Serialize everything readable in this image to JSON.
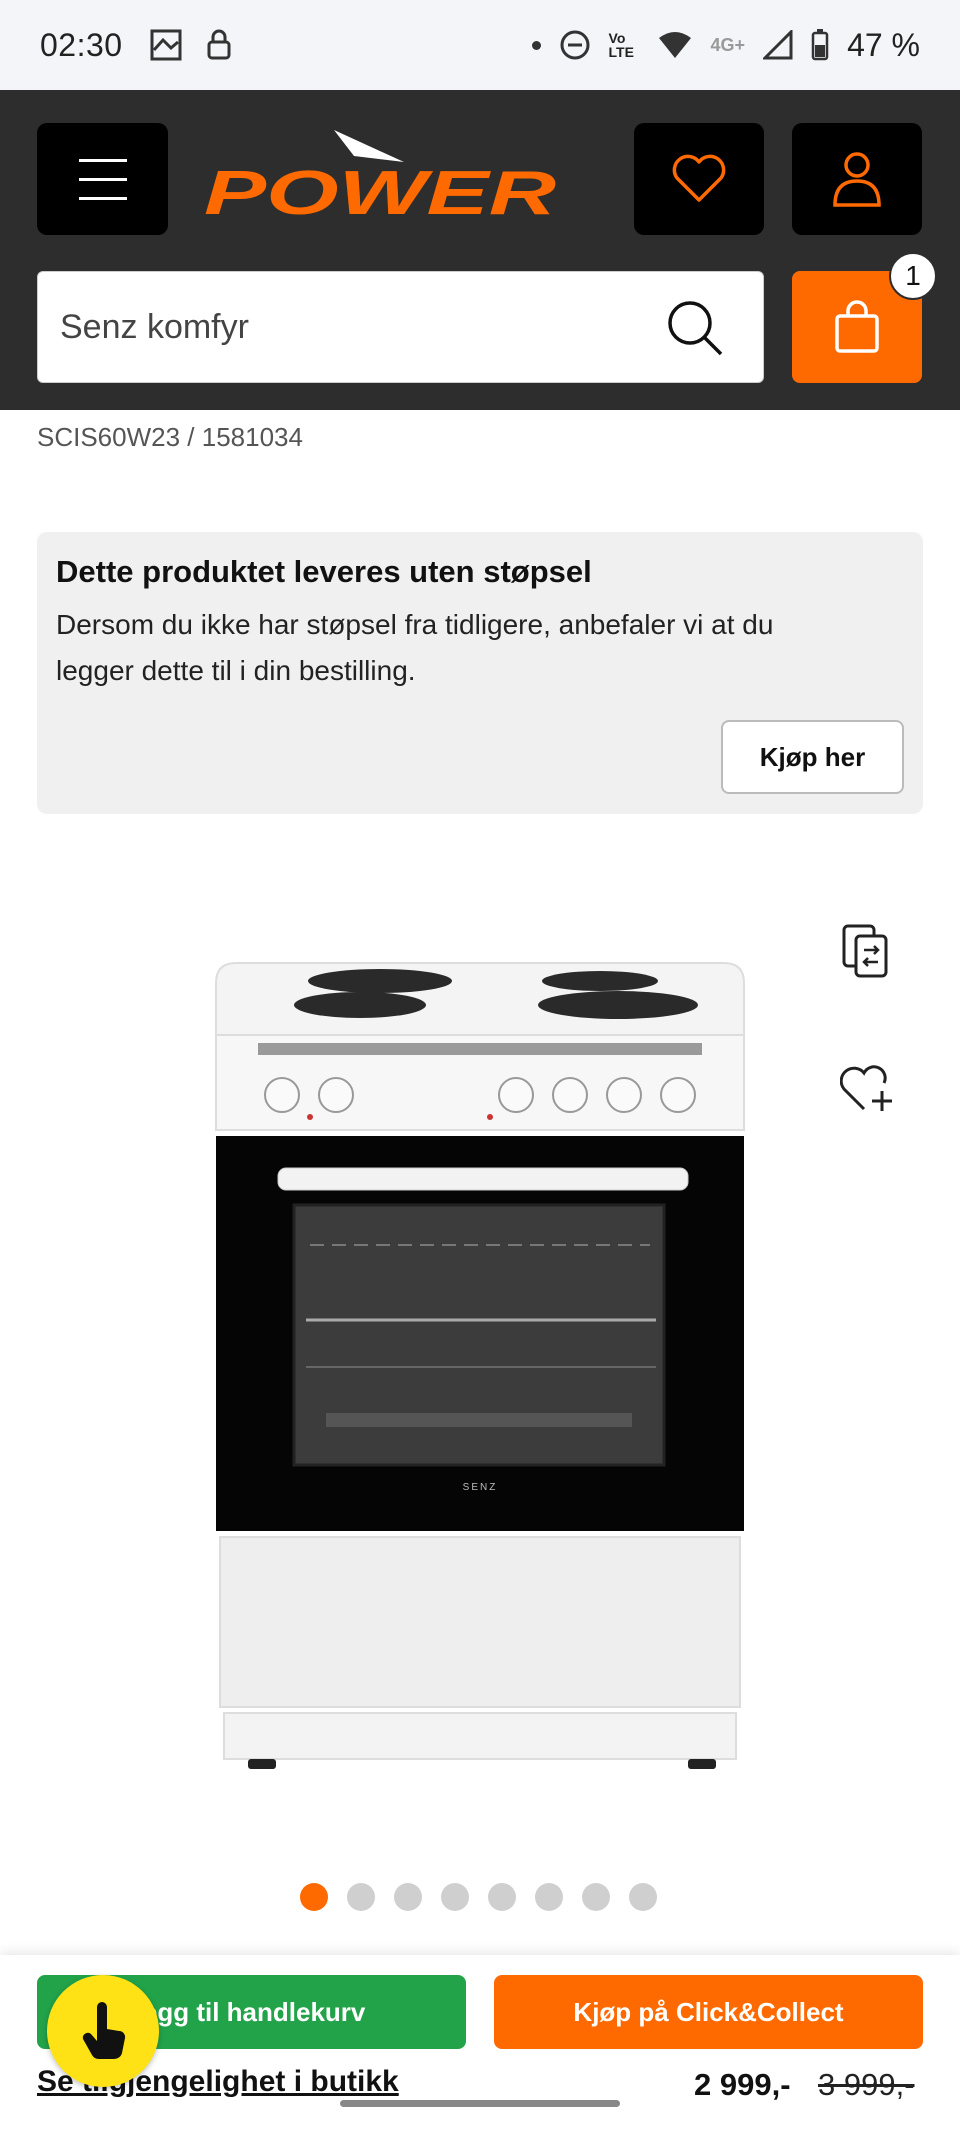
{
  "status_bar": {
    "time": "02:30",
    "battery": "47 %",
    "network": "4G+",
    "volte": "Vo LTE"
  },
  "header": {
    "logo_text": "POWER",
    "search": {
      "placeholder": "Senz komfyr",
      "value": "Senz komfyr"
    },
    "cart_count": "1"
  },
  "product": {
    "sku": "SCIS60W23 / 1581034",
    "brand_on_image": "SENZ"
  },
  "info_box": {
    "title": "Dette produktet leveres uten støpsel",
    "text": "Dersom du ikke har støpsel fra tidligere, anbefaler vi at du legger dette til i din bestilling.",
    "button_label": "Kjøp her"
  },
  "carousel": {
    "total": 8,
    "active_index": 0
  },
  "bottom_bar": {
    "add_to_cart_label": "Legg til handlekurv",
    "click_collect_label": "Kjøp på Click&Collect",
    "availability_link": "Se tilgjengelighet i butikk",
    "price": "2 999,-",
    "old_price": "3 999,-"
  },
  "colors": {
    "brand_orange": "#ff6a00",
    "header_bg": "#2d2d2d",
    "green": "#22a34a",
    "help_yellow": "#ffe215"
  }
}
